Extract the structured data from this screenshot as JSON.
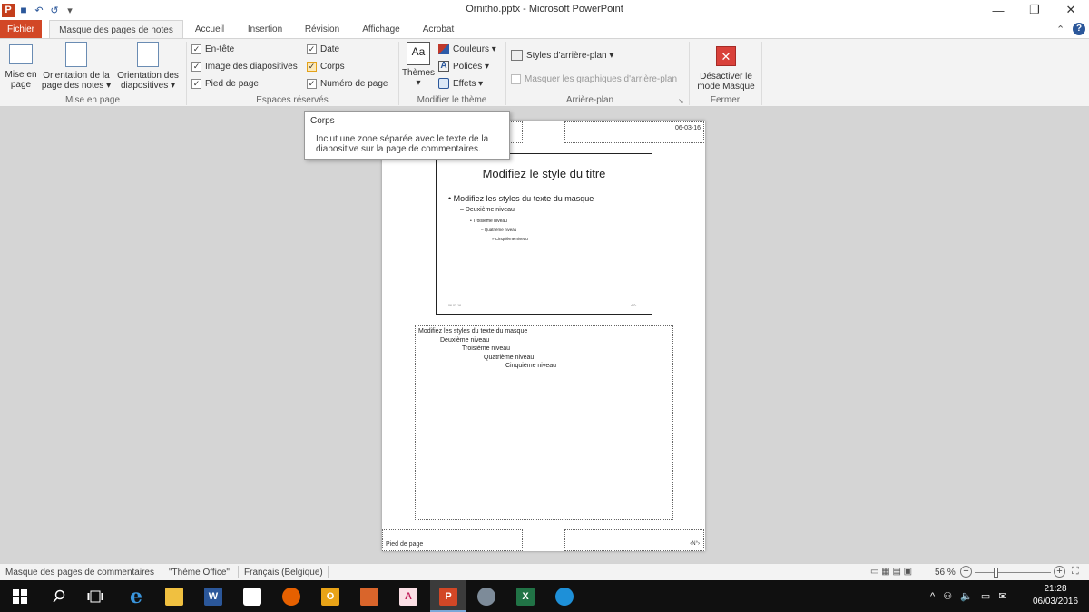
{
  "titlebar": {
    "app_letter": "P",
    "title": "Ornitho.pptx - Microsoft PowerPoint",
    "qat_undo": "↶",
    "qat_redo": "↺",
    "qat_customize": "▾",
    "min": "—",
    "restore": "❐",
    "close": "✕"
  },
  "tabs": {
    "file": "Fichier",
    "notes_master": "Masque des pages de notes",
    "home": "Accueil",
    "insert": "Insertion",
    "review": "Révision",
    "view": "Affichage",
    "acrobat": "Acrobat"
  },
  "ribbon": {
    "mise_en_page": {
      "btn1_l1": "Mise en",
      "btn1_l2": "page",
      "btn2_l1": "Orientation de la",
      "btn2_l2": "page des notes ▾",
      "btn3_l1": "Orientation des",
      "btn3_l2": "diapositives ▾",
      "label": "Mise en page"
    },
    "espaces": {
      "header": "En-tête",
      "slide_image": "Image des diapositives",
      "footer": "Pied de page",
      "date": "Date",
      "body": "Corps",
      "page_number": "Numéro de page",
      "label": "Espaces réservés",
      "check": "✓"
    },
    "theme": {
      "themes": "Thèmes",
      "themes_arrow": "▾",
      "aa": "Aa",
      "colors": "Couleurs ▾",
      "fonts": "Polices ▾",
      "fonts_icon": "A",
      "effects": "Effets ▾",
      "label": "Modifier le thème"
    },
    "background": {
      "styles": "Styles d'arrière-plan ▾",
      "hide": "Masquer les graphiques d'arrière-plan",
      "label": "Arrière-plan",
      "launcher": "↘"
    },
    "close": {
      "btn_l1": "Désactiver le",
      "btn_l2": "mode Masque",
      "label": "Fermer",
      "icon": "✕"
    }
  },
  "ribbon_right": {
    "collapse": "⌃",
    "help": "?"
  },
  "tooltip": {
    "title": "Corps",
    "line1": "Inclut une zone séparée avec le texte de la",
    "line2": "diapositive sur la page de commentaires."
  },
  "notes_page": {
    "date": "06-03-16",
    "slide_title": "Modifiez le style du titre",
    "slide_l1": "Modifiez les styles du texte du masque",
    "slide_l2": "– Deuxième niveau",
    "slide_l3": "• Troisième niveau",
    "slide_l4": "– Quatrième niveau",
    "slide_l5": "» Cinquième niveau",
    "slide_footer_date": "06-03-16",
    "slide_footer_num": "‹N°›",
    "body_l1": "Modifiez les styles du texte du masque",
    "body_l2": "Deuxième niveau",
    "body_l3": "Troisième niveau",
    "body_l4": "Quatrième niveau",
    "body_l5": "Cinquième niveau",
    "footer": "Pied de page",
    "page_num": "‹N°›"
  },
  "status": {
    "view_name": "Masque des pages de commentaires",
    "theme": "\"Thème Office\"",
    "language": "Français (Belgique)",
    "zoom": "56 %",
    "zoom_minus": "−",
    "zoom_plus": "+",
    "view_icons": "▭ ▦ ▤ ▣",
    "fit": "⛶"
  },
  "taskbar": {
    "time": "21:28",
    "date": "06/03/2016",
    "systray": "^ ⚇ 🔈 ▭ ✉",
    "icons": {
      "word": "W",
      "outlook": "O",
      "acrobat": "A",
      "powerpoint": "P",
      "excel": "X",
      "edge": "e"
    }
  }
}
